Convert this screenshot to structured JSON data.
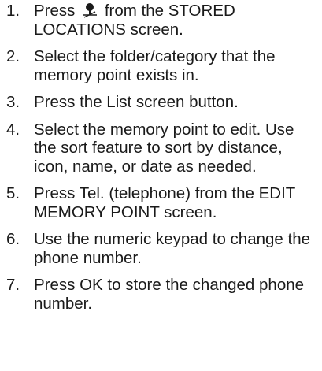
{
  "steps": [
    {
      "number": "1.",
      "before_icon": "Press",
      "icon": "map-pin-icon",
      "text": "from the STORED LOCATIONS screen."
    },
    {
      "number": "2.",
      "text": "Select the folder/category that the memory point exists in."
    },
    {
      "number": "3.",
      "text": "Press the List screen button."
    },
    {
      "number": "4.",
      "text": "Select the memory point to edit. Use the sort feature to sort by distance, icon, name, or date as needed."
    },
    {
      "number": "5.",
      "text": "Press Tel. (telephone) from the EDIT MEMORY POINT screen."
    },
    {
      "number": "6.",
      "text": "Use the numeric keypad to change the phone number."
    },
    {
      "number": "7.",
      "text": "Press OK to store the changed phone number."
    }
  ]
}
